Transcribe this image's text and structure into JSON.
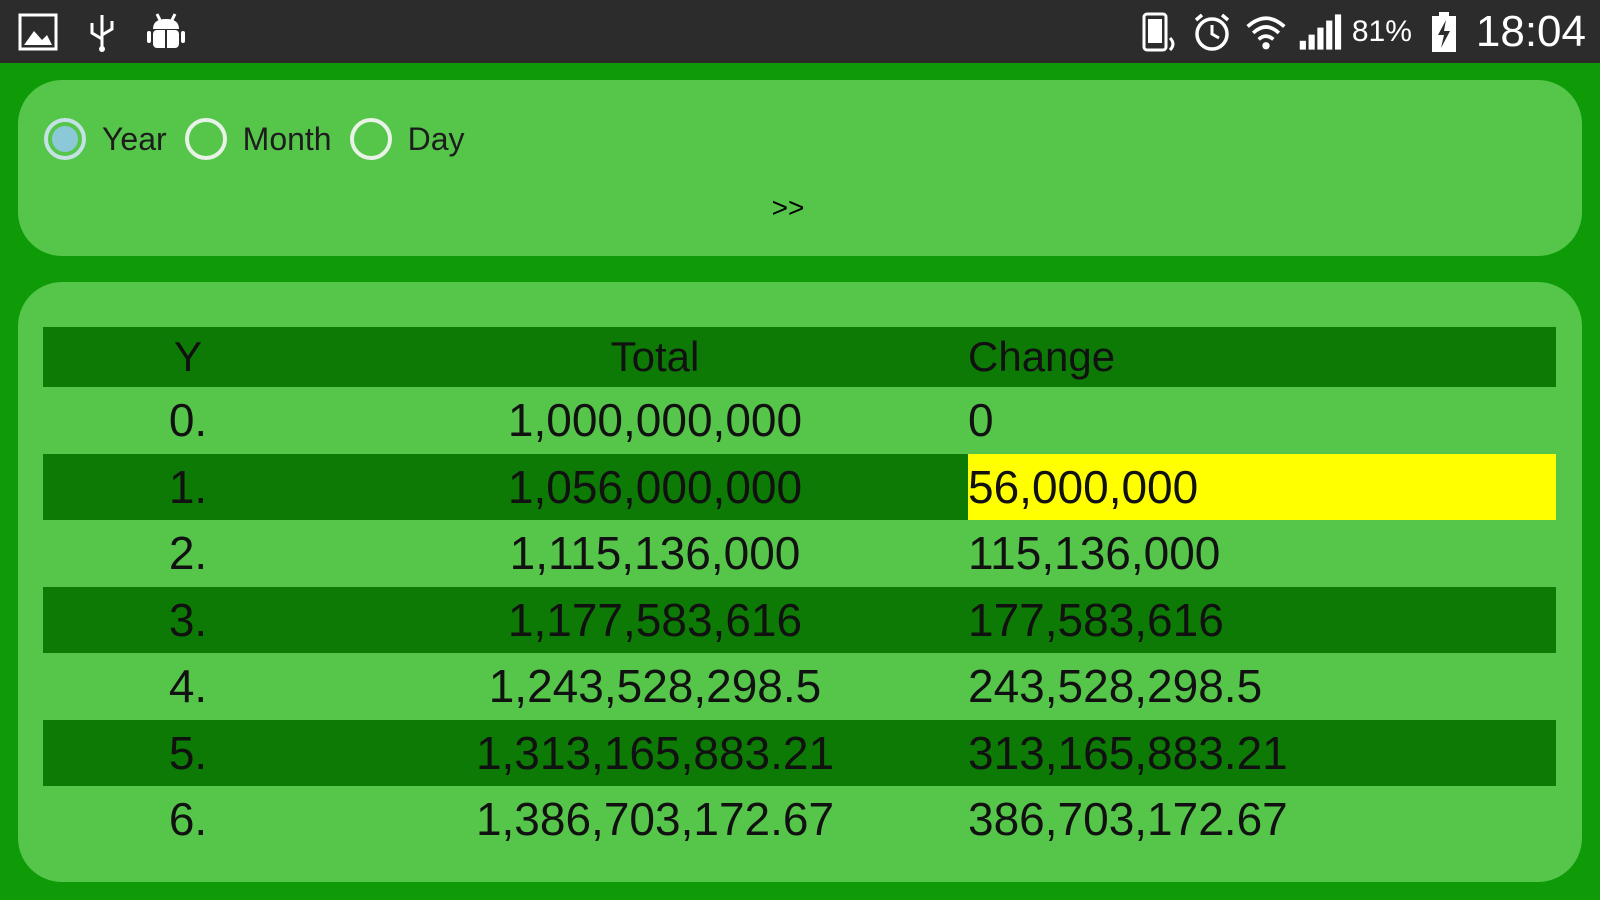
{
  "status_bar": {
    "left_icons": [
      "image-icon",
      "usb-icon",
      "android-debug-icon"
    ],
    "right_icons": [
      "rotation-icon",
      "alarm-icon",
      "wifi-icon",
      "signal-icon"
    ],
    "battery_percent": "81%",
    "clock": "18:04"
  },
  "period_selector": {
    "options": [
      {
        "label": "Year",
        "selected": true
      },
      {
        "label": "Month",
        "selected": false
      },
      {
        "label": "Day",
        "selected": false
      }
    ],
    "next_label": ">>"
  },
  "table": {
    "headers": {
      "y": "Y",
      "total": "Total",
      "change": "Change"
    },
    "rows": [
      {
        "y": "0.",
        "total": "1,000,000,000",
        "change": "0"
      },
      {
        "y": "1.",
        "total": "1,056,000,000",
        "change": "56,000,000",
        "highlight": true
      },
      {
        "y": "2.",
        "total": "1,115,136,000",
        "change": "115,136,000"
      },
      {
        "y": "3.",
        "total": "1,177,583,616",
        "change": "177,583,616"
      },
      {
        "y": "4.",
        "total": "1,243,528,298.5",
        "change": "243,528,298.5"
      },
      {
        "y": "5.",
        "total": "1,313,165,883.21",
        "change": "313,165,883.21"
      },
      {
        "y": "6.",
        "total": "1,386,703,172.67",
        "change": "386,703,172.67"
      }
    ]
  },
  "colors": {
    "background": "#0f9a08",
    "panel": "#56c64b",
    "dark_row": "#0c7a04",
    "highlight": "#ffff00"
  }
}
